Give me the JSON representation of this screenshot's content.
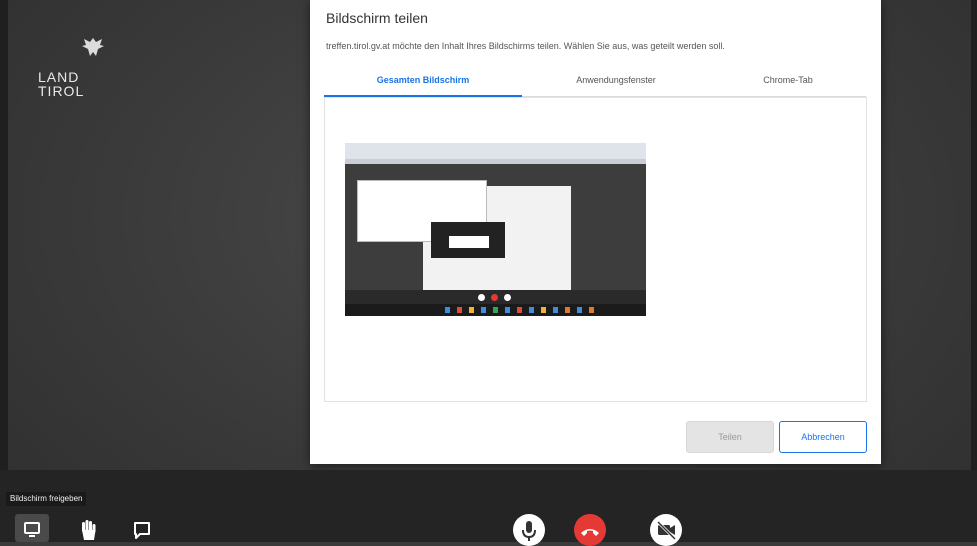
{
  "logo": {
    "line1": "LAND",
    "line2": "TIROL"
  },
  "dialog": {
    "title": "Bildschirm teilen",
    "subtitle": "treffen.tirol.gv.at möchte den Inhalt Ihres Bildschirms teilen. Wählen Sie aus, was geteilt werden soll.",
    "tabs": [
      {
        "label": "Gesamten Bildschirm",
        "active": true
      },
      {
        "label": "Anwendungsfenster",
        "active": false
      },
      {
        "label": "Chrome-Tab",
        "active": false
      }
    ],
    "share_label": "Teilen",
    "cancel_label": "Abbrechen"
  },
  "toolbar": {
    "tooltip": "Bildschirm freigeben",
    "icons": [
      "screen-share-icon",
      "raise-hand-icon",
      "chat-icon",
      "microphone-icon",
      "hang-up-icon",
      "camera-off-icon"
    ]
  },
  "colors": {
    "accent": "#1a73e8",
    "hangup": "#e53935",
    "background": "#3b3b3b",
    "toolbar": "#242424"
  }
}
